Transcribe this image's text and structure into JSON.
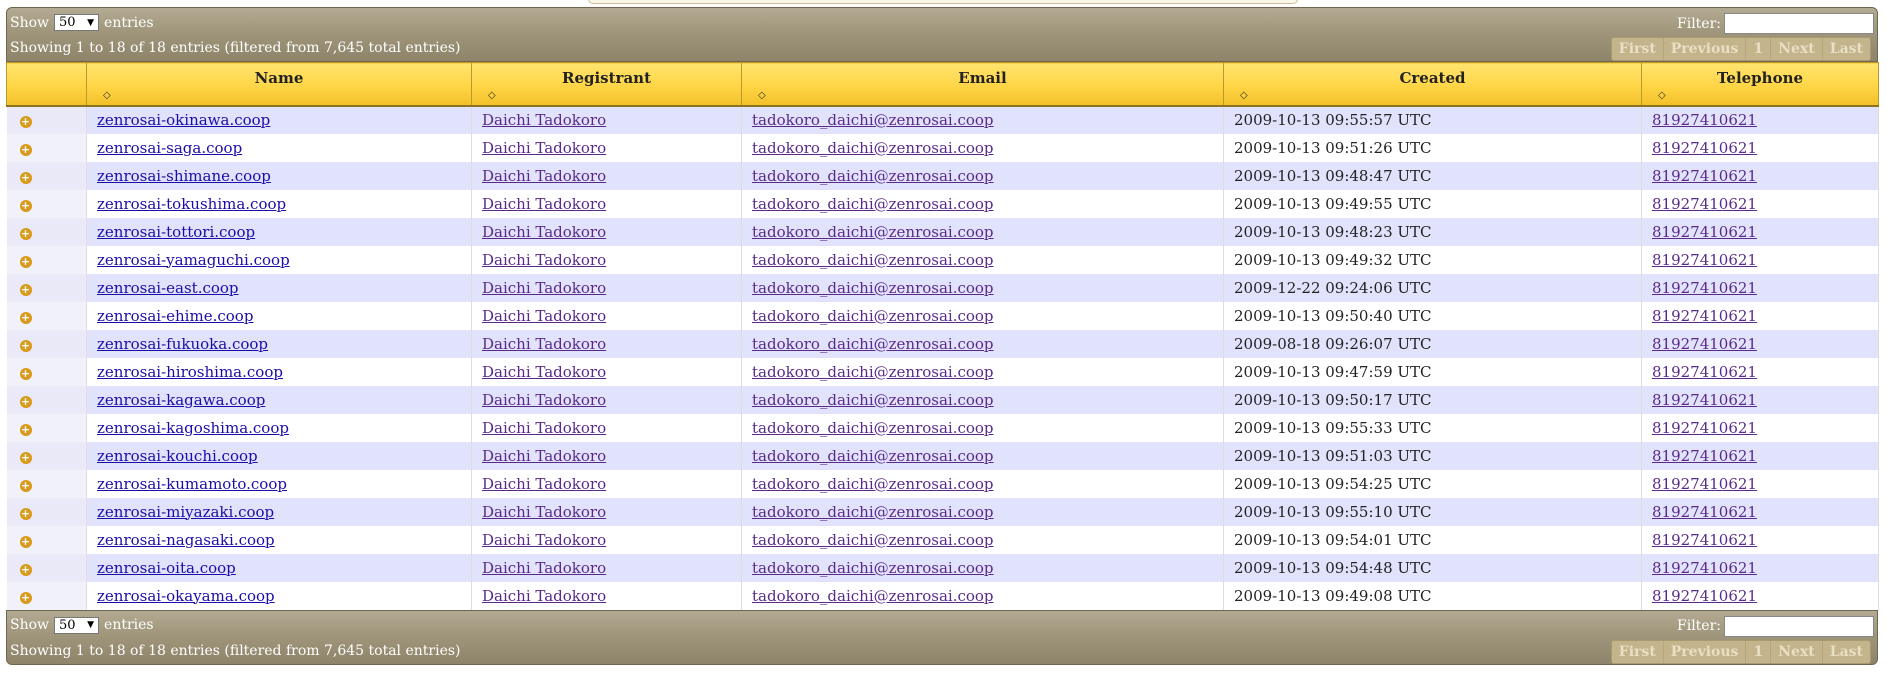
{
  "top_bar": {
    "show_label": "Show",
    "page_size": "50",
    "entries_label": "entries",
    "filter_label": "Filter:",
    "filter_value": "",
    "info": "Showing 1 to 18 of 18 entries (filtered from 7,645 total entries)",
    "pager": [
      "First",
      "Previous",
      "1",
      "Next",
      "Last"
    ]
  },
  "columns": [
    "",
    "Name",
    "Registrant",
    "Email",
    "Created",
    "Telephone"
  ],
  "sort_glyph": "◇",
  "expand_glyph": "+",
  "rows": [
    {
      "name": "zenrosai-okinawa.coop",
      "registrant": "Daichi Tadokoro",
      "email": "tadokoro_daichi@zenrosai.coop",
      "created": "2009-10-13 09:55:57 UTC",
      "telephone": "81927410621"
    },
    {
      "name": "zenrosai-saga.coop",
      "registrant": "Daichi Tadokoro",
      "email": "tadokoro_daichi@zenrosai.coop",
      "created": "2009-10-13 09:51:26 UTC",
      "telephone": "81927410621"
    },
    {
      "name": "zenrosai-shimane.coop",
      "registrant": "Daichi Tadokoro",
      "email": "tadokoro_daichi@zenrosai.coop",
      "created": "2009-10-13 09:48:47 UTC",
      "telephone": "81927410621"
    },
    {
      "name": "zenrosai-tokushima.coop",
      "registrant": "Daichi Tadokoro",
      "email": "tadokoro_daichi@zenrosai.coop",
      "created": "2009-10-13 09:49:55 UTC",
      "telephone": "81927410621"
    },
    {
      "name": "zenrosai-tottori.coop",
      "registrant": "Daichi Tadokoro",
      "email": "tadokoro_daichi@zenrosai.coop",
      "created": "2009-10-13 09:48:23 UTC",
      "telephone": "81927410621"
    },
    {
      "name": "zenrosai-yamaguchi.coop",
      "registrant": "Daichi Tadokoro",
      "email": "tadokoro_daichi@zenrosai.coop",
      "created": "2009-10-13 09:49:32 UTC",
      "telephone": "81927410621"
    },
    {
      "name": "zenrosai-east.coop",
      "registrant": "Daichi Tadokoro",
      "email": "tadokoro_daichi@zenrosai.coop",
      "created": "2009-12-22 09:24:06 UTC",
      "telephone": "81927410621"
    },
    {
      "name": "zenrosai-ehime.coop",
      "registrant": "Daichi Tadokoro",
      "email": "tadokoro_daichi@zenrosai.coop",
      "created": "2009-10-13 09:50:40 UTC",
      "telephone": "81927410621"
    },
    {
      "name": "zenrosai-fukuoka.coop",
      "registrant": "Daichi Tadokoro",
      "email": "tadokoro_daichi@zenrosai.coop",
      "created": "2009-08-18 09:26:07 UTC",
      "telephone": "81927410621"
    },
    {
      "name": "zenrosai-hiroshima.coop",
      "registrant": "Daichi Tadokoro",
      "email": "tadokoro_daichi@zenrosai.coop",
      "created": "2009-10-13 09:47:59 UTC",
      "telephone": "81927410621"
    },
    {
      "name": "zenrosai-kagawa.coop",
      "registrant": "Daichi Tadokoro",
      "email": "tadokoro_daichi@zenrosai.coop",
      "created": "2009-10-13 09:50:17 UTC",
      "telephone": "81927410621"
    },
    {
      "name": "zenrosai-kagoshima.coop",
      "registrant": "Daichi Tadokoro",
      "email": "tadokoro_daichi@zenrosai.coop",
      "created": "2009-10-13 09:55:33 UTC",
      "telephone": "81927410621"
    },
    {
      "name": "zenrosai-kouchi.coop",
      "registrant": "Daichi Tadokoro",
      "email": "tadokoro_daichi@zenrosai.coop",
      "created": "2009-10-13 09:51:03 UTC",
      "telephone": "81927410621"
    },
    {
      "name": "zenrosai-kumamoto.coop",
      "registrant": "Daichi Tadokoro",
      "email": "tadokoro_daichi@zenrosai.coop",
      "created": "2009-10-13 09:54:25 UTC",
      "telephone": "81927410621"
    },
    {
      "name": "zenrosai-miyazaki.coop",
      "registrant": "Daichi Tadokoro",
      "email": "tadokoro_daichi@zenrosai.coop",
      "created": "2009-10-13 09:55:10 UTC",
      "telephone": "81927410621"
    },
    {
      "name": "zenrosai-nagasaki.coop",
      "registrant": "Daichi Tadokoro",
      "email": "tadokoro_daichi@zenrosai.coop",
      "created": "2009-10-13 09:54:01 UTC",
      "telephone": "81927410621"
    },
    {
      "name": "zenrosai-oita.coop",
      "registrant": "Daichi Tadokoro",
      "email": "tadokoro_daichi@zenrosai.coop",
      "created": "2009-10-13 09:54:48 UTC",
      "telephone": "81927410621"
    },
    {
      "name": "zenrosai-okayama.coop",
      "registrant": "Daichi Tadokoro",
      "email": "tadokoro_daichi@zenrosai.coop",
      "created": "2009-10-13 09:49:08 UTC",
      "telephone": "81927410621"
    }
  ],
  "bottom_bar": {
    "show_label": "Show",
    "page_size": "50",
    "entries_label": "entries",
    "filter_label": "Filter:",
    "filter_value": "",
    "info": "Showing 1 to 18 of 18 entries (filtered from 7,645 total entries)",
    "pager": [
      "First",
      "Previous",
      "1",
      "Next",
      "Last"
    ]
  },
  "colors": {
    "header_gold": "#ffd545",
    "bar_taupe": "#a0967b",
    "row_stripe": "#e1e2fb",
    "expand_icon": "#d99a1c"
  }
}
